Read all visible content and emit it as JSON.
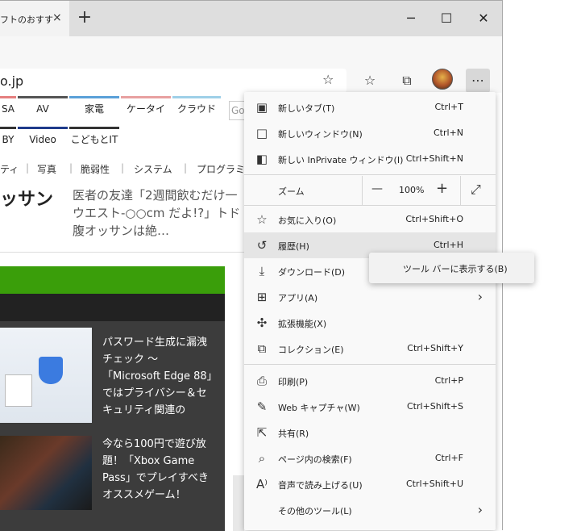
{
  "tab": {
    "title": "フトのおすす",
    "close": "×"
  },
  "newtab": "+",
  "window_controls": {
    "minimize": "─",
    "maximize": "☐",
    "close": "✕"
  },
  "address": {
    "url": "o.jp"
  },
  "toolbar": {
    "favorite": "☆",
    "favorites": "☆",
    "collections": "⧉",
    "more": "⋯"
  },
  "page": {
    "categories_row1": [
      "SA",
      "AV",
      "家電",
      "ケータイ",
      "クラウド"
    ],
    "categories_row2": [
      "BY",
      "Video",
      "こどもとIT"
    ],
    "search_hint": "Go",
    "subnav": [
      "ティ",
      "写真",
      "脆弱性",
      "システム",
      "プログラミ"
    ],
    "headline": "ッサン",
    "desc": "医者の友達「2週間飲むだけ一ウエスト-○○cm だよ!?」トド腹オッサンは絶…",
    "article1": "パスワード生成に漏洩チェック ～「Microsoft Edge 88」ではプライバシー＆セキュリティ関連の",
    "article2": "今なら100円で遊び放題！「Xbox Game Pass」でプレイすべきオススメゲーム！"
  },
  "menu": {
    "new_tab": {
      "label": "新しいタブ(T)",
      "shortcut": "Ctrl+T"
    },
    "new_window": {
      "label": "新しいウィンドウ(N)",
      "shortcut": "Ctrl+N"
    },
    "new_private": {
      "label": "新しい InPrivate ウィンドウ(I)",
      "shortcut": "Ctrl+Shift+N"
    },
    "zoom": {
      "label": "ズーム",
      "minus": "—",
      "value": "100%",
      "plus": "+",
      "full": "⤢"
    },
    "favorites": {
      "label": "お気に入り(O)",
      "shortcut": "Ctrl+Shift+O"
    },
    "history": {
      "label": "履歴(H)",
      "shortcut": "Ctrl+H"
    },
    "downloads": {
      "label": "ダウンロード(D)"
    },
    "apps": {
      "label": "アプリ(A)"
    },
    "extensions": {
      "label": "拡張機能(X)"
    },
    "collections": {
      "label": "コレクション(E)",
      "shortcut": "Ctrl+Shift+Y"
    },
    "print": {
      "label": "印刷(P)",
      "shortcut": "Ctrl+P"
    },
    "web_capture": {
      "label": "Web キャプチャ(W)",
      "shortcut": "Ctrl+Shift+S"
    },
    "share": {
      "label": "共有(R)"
    },
    "find": {
      "label": "ページ内の検索(F)",
      "shortcut": "Ctrl+F"
    },
    "read_aloud": {
      "label": "音声で読み上げる(U)",
      "shortcut": "Ctrl+Shift+U"
    },
    "more_tools": {
      "label": "その他のツール(L)"
    }
  },
  "submenu": {
    "show_toolbar": "ツール バーに表示する(B)"
  },
  "colors": {
    "green": "#3a9e0a",
    "dark": "#222222",
    "menu_bg": "#f9f9f9",
    "highlight": "#e5e5e5"
  }
}
